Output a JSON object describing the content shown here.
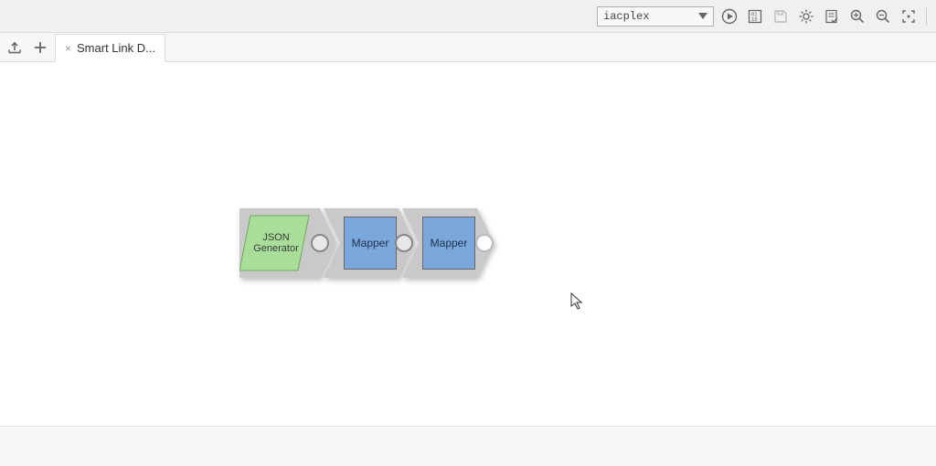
{
  "toolbar": {
    "env_selected": "iacplex"
  },
  "tabs": {
    "active_label": "Smart Link D..."
  },
  "pipeline": {
    "nodes": [
      {
        "label_line1": "JSON",
        "label_line2": "Generator",
        "type": "json-generator"
      },
      {
        "label": "Mapper",
        "type": "mapper"
      },
      {
        "label": "Mapper",
        "type": "mapper"
      }
    ]
  }
}
